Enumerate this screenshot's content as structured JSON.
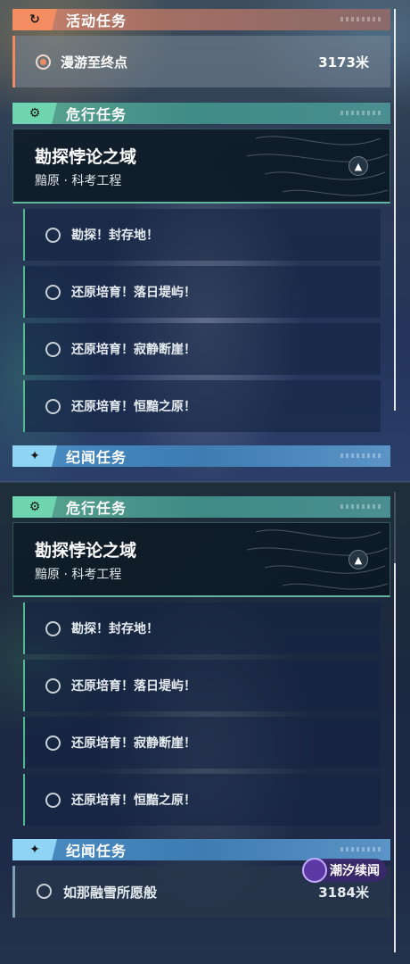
{
  "colors": {
    "active_accent": "#f08a62",
    "danger_accent": "#6fd4b0",
    "chronicle_accent": "#8fd4f5",
    "watermark_bg": "#5b3aa6"
  },
  "top_panel": {
    "active_section": {
      "title": "活动任务",
      "icon": "refresh-icon",
      "quest": {
        "name": "漫游至终点",
        "distance": "3173米"
      }
    },
    "danger_section": {
      "title": "危行任务",
      "icon": "gear-eye-icon",
      "mission": {
        "title": "勘探悖论之域",
        "subtitle": "黯原 · 科考工程"
      },
      "subtasks": [
        "勘探！封存地！",
        "还原培育！落日堤屿！",
        "还原培育！寂静断崖！",
        "还原培育！恒黯之原！"
      ]
    },
    "chronicle_section": {
      "title": "纪闻任务",
      "icon": "sparkle-icon"
    }
  },
  "bottom_panel": {
    "danger_section": {
      "title": "危行任务",
      "icon": "gear-eye-icon",
      "mission": {
        "title": "勘探悖论之域",
        "subtitle": "黯原 · 科考工程"
      },
      "subtasks": [
        "勘探！封存地！",
        "还原培育！落日堤屿！",
        "还原培育！寂静断崖！",
        "还原培育！恒黯之原！"
      ]
    },
    "chronicle_section": {
      "title": "纪闻任务",
      "icon": "sparkle-icon",
      "quest": {
        "name": "如那融雪所愿般",
        "distance": "3184米"
      }
    }
  },
  "watermark": {
    "text": "潮汐续闻"
  }
}
